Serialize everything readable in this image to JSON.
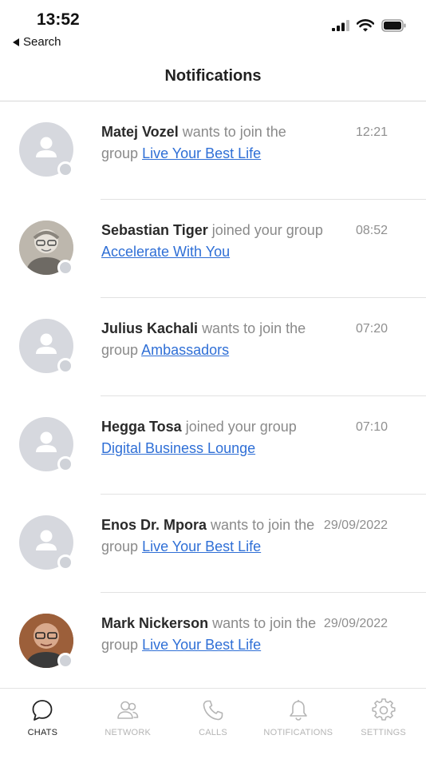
{
  "status_bar": {
    "time": "13:52",
    "back_label": "Search"
  },
  "header": {
    "title": "Notifications"
  },
  "notifications": [
    {
      "name": "Matej Vozel",
      "action": "wants to join the group",
      "group": "Live Your Best Life",
      "time": "12:21",
      "avatar": "placeholder"
    },
    {
      "name": "Sebastian Tiger",
      "action": "joined your group",
      "group": "Accelerate With You",
      "time": "08:52",
      "avatar": "photo"
    },
    {
      "name": "Julius Kachali",
      "action": "wants to join the group",
      "group": "Ambassadors",
      "time": "07:20",
      "avatar": "placeholder"
    },
    {
      "name": "Hegga Tosa",
      "action": "joined your group",
      "group": "Digital Business Lounge",
      "time": "07:10",
      "avatar": "placeholder"
    },
    {
      "name": "Enos Dr. Mpora",
      "action": "wants to join the group",
      "group": "Live Your Best Life",
      "time": "29/09/2022",
      "avatar": "placeholder"
    },
    {
      "name": "Mark Nickerson",
      "action": "wants to join the group",
      "group": "Live Your Best Life",
      "time": "29/09/2022",
      "avatar": "photo"
    }
  ],
  "tabs": [
    {
      "label": "CHATS",
      "icon": "chat-bubble-icon",
      "active": true
    },
    {
      "label": "NETWORK",
      "icon": "people-icon",
      "active": false
    },
    {
      "label": "CALLS",
      "icon": "phone-icon",
      "active": false
    },
    {
      "label": "NOTIFICATIONS",
      "icon": "bell-icon",
      "active": false
    },
    {
      "label": "SETTINGS",
      "icon": "gear-icon",
      "active": false
    }
  ],
  "colors": {
    "link": "#2f6fd6",
    "avatar_placeholder": "#d6d8de",
    "inactive_tab": "#b5b5b5"
  }
}
